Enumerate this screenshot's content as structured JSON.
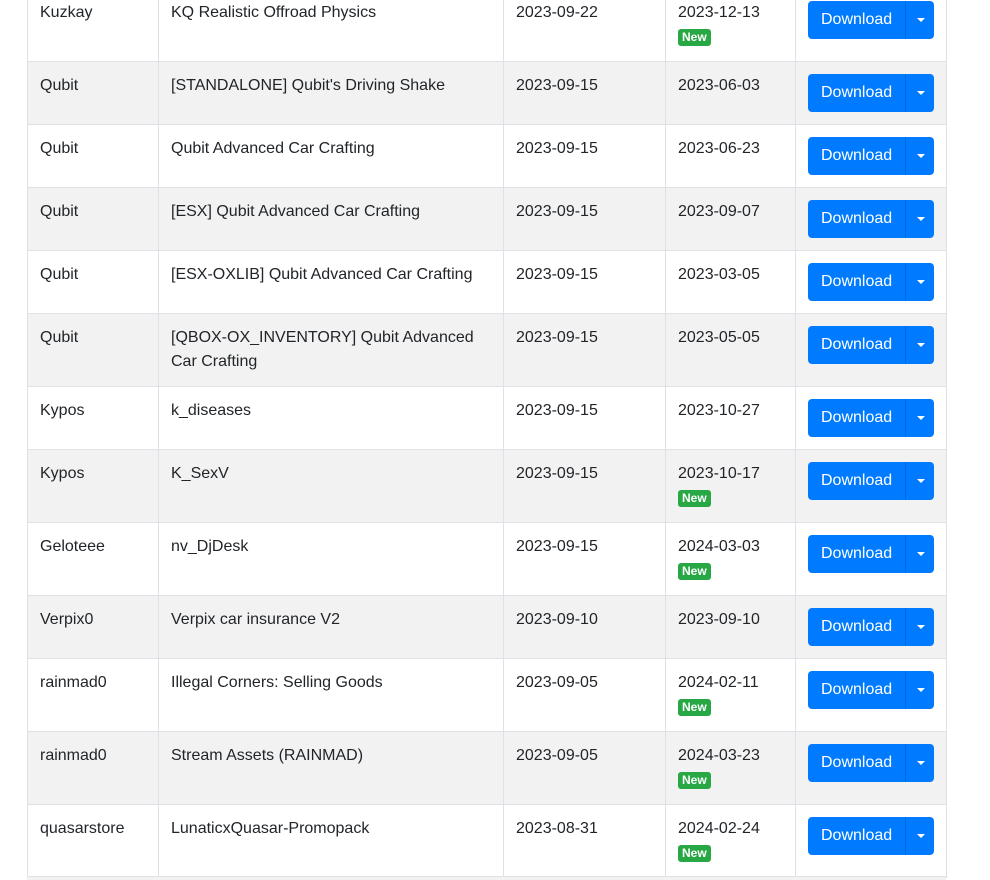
{
  "table": {
    "rows": [
      {
        "author": "Kuzkay",
        "name": "KQ Realistic Offroad Physics",
        "date1": "2023-09-22",
        "date2": "2023-12-13",
        "is_new": true
      },
      {
        "author": "Qubit",
        "name": "[STANDALONE] Qubit's Driving Shake",
        "date1": "2023-09-15",
        "date2": "2023-06-03",
        "is_new": false
      },
      {
        "author": "Qubit",
        "name": "Qubit Advanced Car Crafting",
        "date1": "2023-09-15",
        "date2": "2023-06-23",
        "is_new": false
      },
      {
        "author": "Qubit",
        "name": "[ESX] Qubit Advanced Car Crafting",
        "date1": "2023-09-15",
        "date2": "2023-09-07",
        "is_new": false
      },
      {
        "author": "Qubit",
        "name": "[ESX-OXLIB] Qubit Advanced Car Crafting",
        "date1": "2023-09-15",
        "date2": "2023-03-05",
        "is_new": false
      },
      {
        "author": "Qubit",
        "name": "[QBOX-OX_INVENTORY] Qubit Advanced Car Crafting",
        "date1": "2023-09-15",
        "date2": "2023-05-05",
        "is_new": false
      },
      {
        "author": "Kypos",
        "name": "k_diseases",
        "date1": "2023-09-15",
        "date2": "2023-10-27",
        "is_new": false
      },
      {
        "author": "Kypos",
        "name": "K_SexV",
        "date1": "2023-09-15",
        "date2": "2023-10-17",
        "is_new": true
      },
      {
        "author": "Geloteee",
        "name": "nv_DjDesk",
        "date1": "2023-09-15",
        "date2": "2024-03-03",
        "is_new": true
      },
      {
        "author": "Verpix0",
        "name": "Verpix car insurance V2",
        "date1": "2023-09-10",
        "date2": "2023-09-10",
        "is_new": false
      },
      {
        "author": "rainmad0",
        "name": "Illegal Corners: Selling Goods",
        "date1": "2023-09-05",
        "date2": "2024-02-11",
        "is_new": true
      },
      {
        "author": "rainmad0",
        "name": "Stream Assets (RAINMAD)",
        "date1": "2023-09-05",
        "date2": "2024-03-23",
        "is_new": true
      },
      {
        "author": "quasarstore",
        "name": "LunaticxQuasar-Promopack",
        "date1": "2023-08-31",
        "date2": "2024-02-24",
        "is_new": true
      }
    ],
    "badge_label": "New",
    "download_label": "Download"
  },
  "colors": {
    "primary": "#007bff",
    "success": "#28a745",
    "stripe": "#f2f2f2",
    "border": "#dee2e6"
  }
}
